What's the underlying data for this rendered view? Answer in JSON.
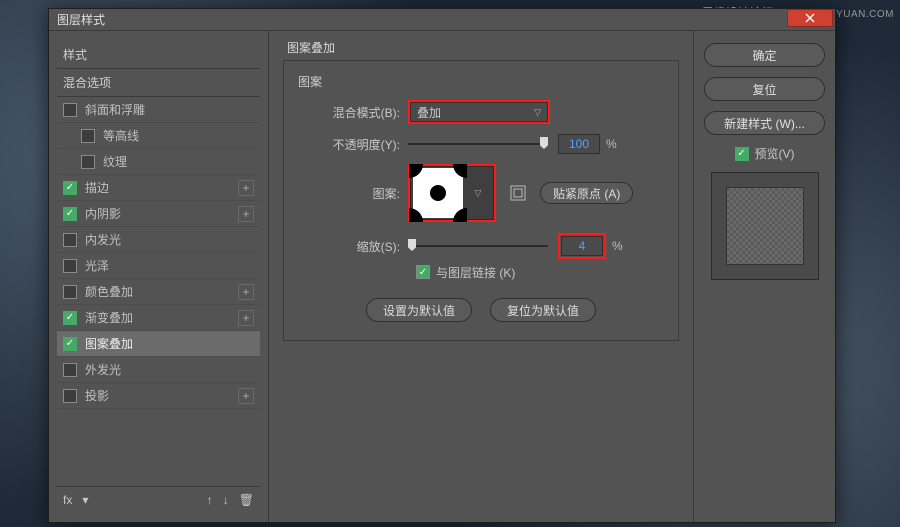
{
  "watermark": {
    "line1": "思缘设计论坛",
    "line2": "WWW.MISSYUAN.COM"
  },
  "dialog": {
    "title": "图层样式"
  },
  "left": {
    "header1": "样式",
    "header2": "混合选项",
    "items": [
      {
        "label": "斜面和浮雕",
        "checked": false,
        "indent": false,
        "plus": false,
        "sel": false
      },
      {
        "label": "等高线",
        "checked": false,
        "indent": true,
        "plus": false,
        "sel": false
      },
      {
        "label": "纹理",
        "checked": false,
        "indent": true,
        "plus": false,
        "sel": false
      },
      {
        "label": "描边",
        "checked": true,
        "indent": false,
        "plus": true,
        "sel": false
      },
      {
        "label": "内阴影",
        "checked": true,
        "indent": false,
        "plus": true,
        "sel": false
      },
      {
        "label": "内发光",
        "checked": false,
        "indent": false,
        "plus": false,
        "sel": false
      },
      {
        "label": "光泽",
        "checked": false,
        "indent": false,
        "plus": false,
        "sel": false
      },
      {
        "label": "颜色叠加",
        "checked": false,
        "indent": false,
        "plus": true,
        "sel": false
      },
      {
        "label": "渐变叠加",
        "checked": true,
        "indent": false,
        "plus": true,
        "sel": false
      },
      {
        "label": "图案叠加",
        "checked": true,
        "indent": false,
        "plus": false,
        "sel": true
      },
      {
        "label": "外发光",
        "checked": false,
        "indent": false,
        "plus": false,
        "sel": false
      },
      {
        "label": "投影",
        "checked": false,
        "indent": false,
        "plus": true,
        "sel": false
      }
    ],
    "footer": {
      "fx": "fx",
      "up": "↑",
      "down": "↓",
      "trash": "🗑"
    }
  },
  "mid": {
    "groupTitle": "图案叠加",
    "subTitle": "图案",
    "blend": {
      "label": "混合模式(B):",
      "value": "叠加"
    },
    "opacity": {
      "label": "不透明度(Y):",
      "value": "100",
      "pct": "%",
      "thumb": 100
    },
    "pattern": {
      "label": "图案:",
      "snap": "贴紧原点 (A)"
    },
    "scale": {
      "label": "缩放(S):",
      "value": "4",
      "pct": "%",
      "thumb": 2
    },
    "link": {
      "label": "与图层链接 (K)"
    },
    "defaults": {
      "set": "设置为默认值",
      "reset": "复位为默认值"
    }
  },
  "right": {
    "ok": "确定",
    "reset": "复位",
    "newStyle": "新建样式 (W)...",
    "preview": "预览(V)"
  }
}
